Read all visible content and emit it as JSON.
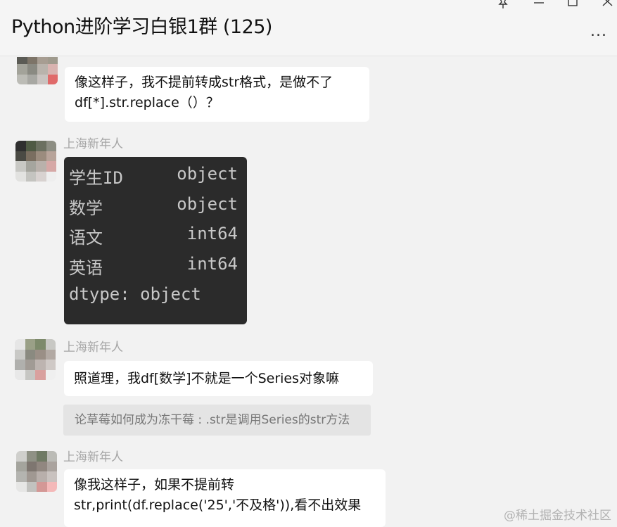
{
  "header": {
    "title": "Python进阶学习白银1群 (125)",
    "icons": [
      "pin-icon",
      "minimize-icon",
      "maximize-icon",
      "close-icon",
      "more-icon"
    ],
    "more_label": "..."
  },
  "messages": [
    {
      "sender": "",
      "lines": [
        "像这样子，我不提前转成str格式，是做不了",
        "df[*].str.replace（）？"
      ]
    },
    {
      "sender": "上海新年人",
      "code_image": {
        "rows": [
          {
            "key": "学生ID",
            "value": "object"
          },
          {
            "key": "数学",
            "value": "object"
          },
          {
            "key": "语文",
            "value": "int64"
          },
          {
            "key": "英语",
            "value": "int64"
          }
        ],
        "footer": "dtype: object"
      }
    },
    {
      "sender": "上海新年人",
      "lines": [
        "照道理，我df[数学]不就是一个Series对象嘛"
      ],
      "quote": "论草莓如何成为冻干莓 : .str是调用Series的str方法"
    },
    {
      "sender": "上海新年人",
      "lines": [
        "像我这样子，如果不提前转",
        "str,print(df.replace('25','不及格')),看不出效果"
      ]
    }
  ],
  "watermark": "@稀土掘金技术社区",
  "colors": {
    "background": "#f2f2f2",
    "bubble": "#ffffff",
    "code_bg": "#2b2b2b",
    "sender_gray": "#a5a5a5",
    "quote_bg": "#e4e4e4"
  }
}
